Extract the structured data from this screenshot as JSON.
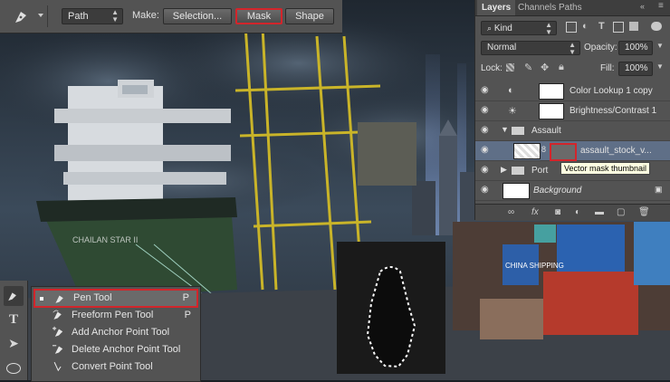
{
  "options_bar": {
    "mode_value": "Path",
    "make_label": "Make:",
    "selection_label": "Selection...",
    "mask_label": "Mask",
    "shape_label": "Shape"
  },
  "layers_panel": {
    "tabs": [
      "Layers",
      "Channels",
      "Paths"
    ],
    "filter_value": "Kind",
    "blend_mode": "Normal",
    "opacity_label": "Opacity:",
    "opacity_value": "100%",
    "lock_label": "Lock:",
    "fill_label": "Fill:",
    "fill_value": "100%",
    "layers": [
      {
        "name": "Color Lookup 1 copy"
      },
      {
        "name": "Brightness/Contrast 1"
      },
      {
        "name": "Assault"
      },
      {
        "name": "assault_stock_v..."
      },
      {
        "name": "Port"
      },
      {
        "name": "Background"
      }
    ],
    "tooltip": "Vector mask thumbnail"
  },
  "flyout": {
    "items": [
      {
        "label": "Pen Tool",
        "key": "P",
        "icon": "pen-icon"
      },
      {
        "label": "Freeform Pen Tool",
        "key": "P",
        "icon": "freeform-pen-icon"
      },
      {
        "label": "Add Anchor Point Tool",
        "key": "",
        "icon": "add-anchor-point-icon"
      },
      {
        "label": "Delete Anchor Point Tool",
        "key": "",
        "icon": "delete-anchor-point-icon"
      },
      {
        "label": "Convert Point Tool",
        "key": "",
        "icon": "convert-point-icon"
      }
    ]
  },
  "canvas_text": {
    "ship_name": "CHAILAN STAR II",
    "container_label": "CHINA SHIPPING"
  },
  "colors": {
    "highlight": "#d2252b",
    "panel": "#535353",
    "selected_layer": "#5f6f87"
  }
}
